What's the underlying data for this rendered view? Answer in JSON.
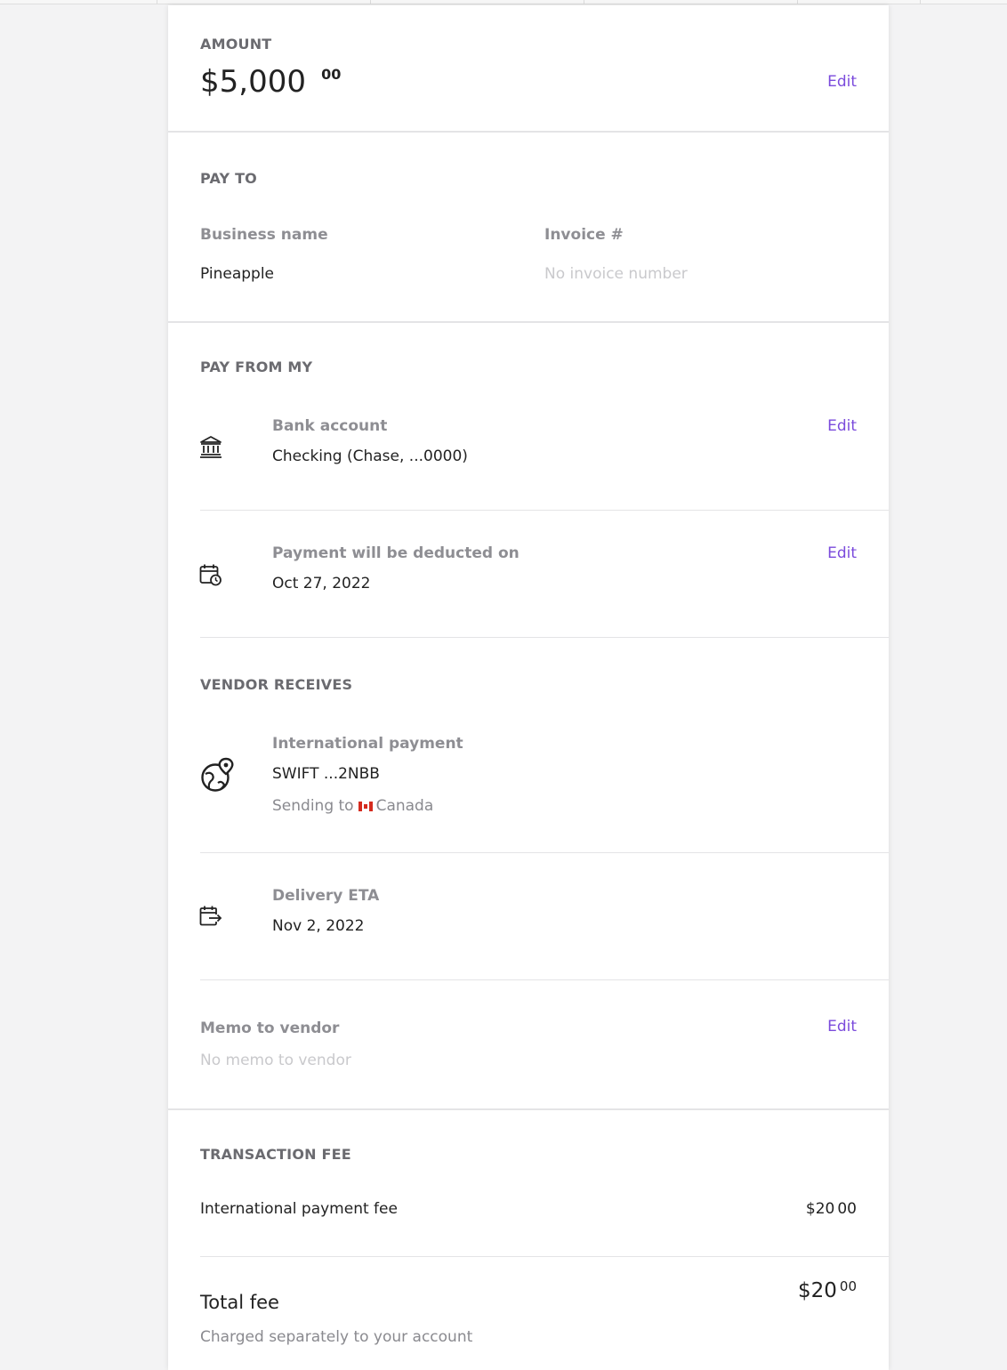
{
  "amount": {
    "section_title": "AMOUNT",
    "value": "$5,000",
    "cents": "00",
    "edit_label": "Edit"
  },
  "pay_to": {
    "section_title": "PAY TO",
    "business_label": "Business name",
    "business_value": "Pineapple",
    "invoice_label": "Invoice #",
    "invoice_placeholder": "No invoice number"
  },
  "pay_from": {
    "section_title": "PAY FROM MY",
    "bank_label": "Bank account",
    "bank_value": "Checking (Chase, ...0000)",
    "bank_edit": "Edit",
    "deduct_label": "Payment will be deducted on",
    "deduct_value": "Oct 27, 2022",
    "deduct_edit": "Edit"
  },
  "vendor": {
    "section_title": "VENDOR RECEIVES",
    "method_label": "International payment",
    "method_value": "SWIFT ...2NBB",
    "sending_prefix": "Sending to",
    "country": "Canada",
    "eta_label": "Delivery ETA",
    "eta_value": "Nov 2, 2022",
    "memo_label": "Memo to vendor",
    "memo_placeholder": "No memo to vendor",
    "memo_edit": "Edit"
  },
  "fee": {
    "section_title": "TRANSACTION FEE",
    "item_label": "International payment fee",
    "item_value": "$20",
    "item_cents": "00",
    "total_label": "Total fee",
    "total_value": "$20",
    "total_cents": "00",
    "note": "Charged separately to your account"
  },
  "icons": {
    "bank": "bank-icon",
    "calendar_clock": "calendar-clock-icon",
    "globe_pin": "globe-pin-icon",
    "calendar_arrow": "calendar-arrow-icon",
    "flag": "canada-flag-icon"
  },
  "colors": {
    "accent": "#7b4bdc"
  }
}
